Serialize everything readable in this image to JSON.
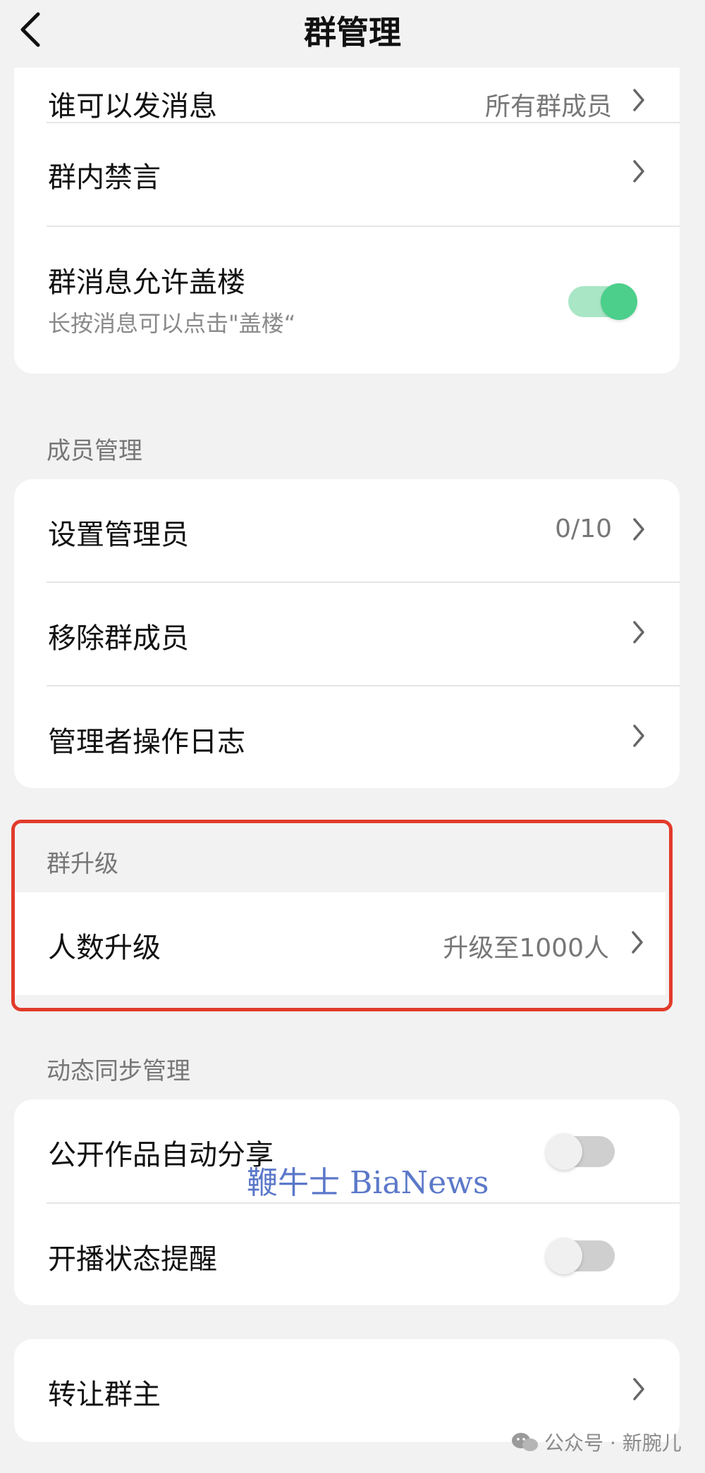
{
  "header": {
    "title": "群管理"
  },
  "card1": {
    "rows": [
      {
        "label": "谁可以发消息",
        "value": "所有群成员"
      },
      {
        "label": "群内禁言"
      },
      {
        "label": "群消息允许盖楼",
        "sub": "长按消息可以点击\"盖楼“",
        "toggle": "on"
      }
    ]
  },
  "members": {
    "section": "成员管理",
    "rows": [
      {
        "label": "设置管理员",
        "value": "0/10"
      },
      {
        "label": "移除群成员"
      },
      {
        "label": "管理者操作日志"
      }
    ]
  },
  "upgrade": {
    "section": "群升级",
    "row": {
      "label": "人数升级",
      "value": "升级至1000人"
    }
  },
  "dynamic": {
    "section": "动态同步管理",
    "rows": [
      {
        "label": "公开作品自动分享",
        "toggle": "off"
      },
      {
        "label": "开播状态提醒",
        "toggle": "off"
      }
    ]
  },
  "transfer": {
    "label": "转让群主"
  },
  "watermark": "鞭牛士 BiaNews",
  "credit": "公众号 · 新腕儿",
  "colors": {
    "toggle_on": "#4ccf8b",
    "toggle_off": "#cfcfcf",
    "highlight_border": "#e23b2b",
    "watermark": "#5b78c9"
  },
  "icons": {
    "back": "back-chevron-icon",
    "row_arrow": "chevron-right-icon",
    "credit": "wechat-icon"
  }
}
